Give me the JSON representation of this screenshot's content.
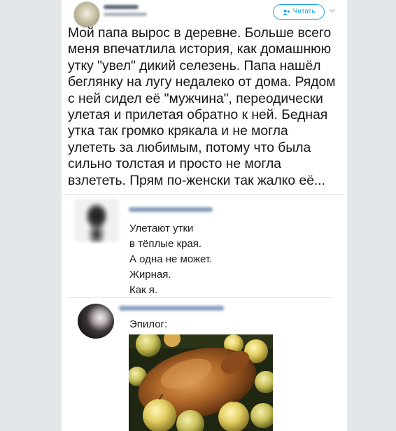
{
  "tweet": {
    "follow_label": "Читать",
    "text": "Мой папа вырос в деревне. Больше всего\nменя впечатлила история, как домашнюю\nутку \"увел\" дикий селезень. Папа нашёл\nбеглянку на лугу недалеко от дома. Рядом\nс ней сидел её \"мужчина\", переодически\nулетая и прилетая обратно к ней. Бедная\nутка так громко крякала и не могла\nулететь за любимым, потому что была\nсильно толстая и просто не могла\nвзлететь. Прям по-женски так жалко её..."
  },
  "replies": [
    {
      "text": "Улетают утки\nв тёплые края.\nА одна не может.\nЖирная.\nКак я."
    },
    {
      "text": "Эпилог:",
      "image": "roast-duck-with-apples"
    }
  ],
  "colors": {
    "accent": "#1da1f2",
    "page_bg": "#e4e7ea"
  }
}
